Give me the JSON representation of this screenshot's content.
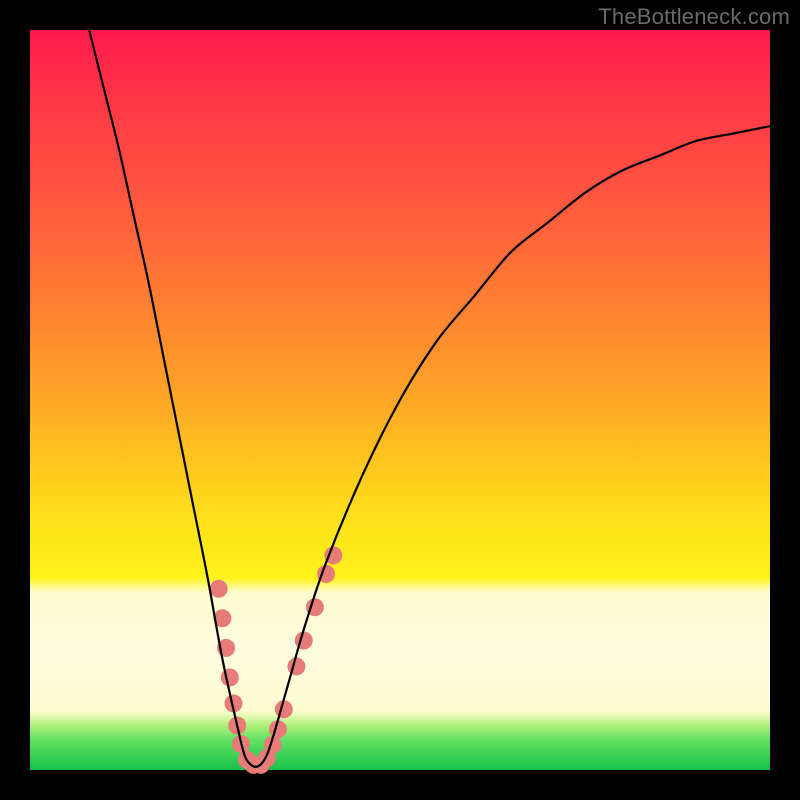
{
  "watermark": "TheBottleneck.com",
  "chart_data": {
    "type": "line",
    "title": "",
    "xlabel": "",
    "ylabel": "",
    "xlim": [
      0,
      100
    ],
    "ylim": [
      0,
      100
    ],
    "grid": false,
    "curve": {
      "name": "bottleneck-curve",
      "color": "#000000",
      "thickness_px": 2.2,
      "points": [
        {
          "x": 8,
          "y": 100
        },
        {
          "x": 10,
          "y": 92
        },
        {
          "x": 12,
          "y": 84
        },
        {
          "x": 14,
          "y": 75
        },
        {
          "x": 16,
          "y": 66
        },
        {
          "x": 18,
          "y": 56
        },
        {
          "x": 20,
          "y": 46
        },
        {
          "x": 22,
          "y": 36
        },
        {
          "x": 24,
          "y": 26
        },
        {
          "x": 26,
          "y": 15
        },
        {
          "x": 28,
          "y": 6
        },
        {
          "x": 29,
          "y": 2
        },
        {
          "x": 30,
          "y": 0.6
        },
        {
          "x": 31,
          "y": 0.6
        },
        {
          "x": 32,
          "y": 2
        },
        {
          "x": 33,
          "y": 5
        },
        {
          "x": 35,
          "y": 12
        },
        {
          "x": 37,
          "y": 19
        },
        {
          "x": 40,
          "y": 28
        },
        {
          "x": 45,
          "y": 40
        },
        {
          "x": 50,
          "y": 50
        },
        {
          "x": 55,
          "y": 58
        },
        {
          "x": 60,
          "y": 64
        },
        {
          "x": 65,
          "y": 70
        },
        {
          "x": 70,
          "y": 74
        },
        {
          "x": 75,
          "y": 78
        },
        {
          "x": 80,
          "y": 81
        },
        {
          "x": 85,
          "y": 83
        },
        {
          "x": 90,
          "y": 85
        },
        {
          "x": 95,
          "y": 86
        },
        {
          "x": 100,
          "y": 87
        }
      ]
    },
    "markers": {
      "name": "highlight-markers",
      "color": "#e77b78",
      "radius_px": 9,
      "points": [
        {
          "x": 25.5,
          "y": 24.5
        },
        {
          "x": 26.0,
          "y": 20.5
        },
        {
          "x": 26.5,
          "y": 16.5
        },
        {
          "x": 27.0,
          "y": 12.5
        },
        {
          "x": 27.5,
          "y": 9.0
        },
        {
          "x": 28.0,
          "y": 6.0
        },
        {
          "x": 28.5,
          "y": 3.5
        },
        {
          "x": 29.3,
          "y": 1.4
        },
        {
          "x": 30.2,
          "y": 0.7
        },
        {
          "x": 31.2,
          "y": 0.7
        },
        {
          "x": 32.0,
          "y": 1.6
        },
        {
          "x": 32.8,
          "y": 3.4
        },
        {
          "x": 33.5,
          "y": 5.5
        },
        {
          "x": 34.3,
          "y": 8.2
        },
        {
          "x": 36.0,
          "y": 14.0
        },
        {
          "x": 37.0,
          "y": 17.5
        },
        {
          "x": 38.5,
          "y": 22.0
        },
        {
          "x": 40.0,
          "y": 26.5
        },
        {
          "x": 41.0,
          "y": 29.0
        }
      ]
    }
  }
}
